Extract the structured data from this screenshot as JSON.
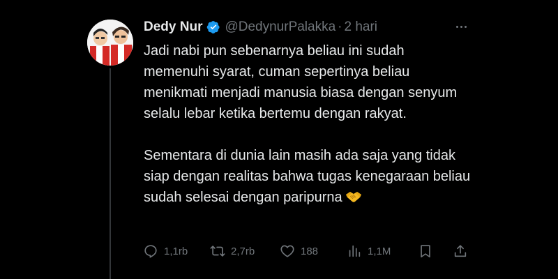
{
  "tweet": {
    "author": {
      "display_name": "Dedy Nur",
      "handle": "@DedynurPalakka",
      "verified": true,
      "avatar_icon": "avatar-illustration"
    },
    "separator": "·",
    "time": "2 hari",
    "more_icon": "more-dots-icon",
    "paragraphs": [
      "Jadi nabi pun sebenarnya beliau ini sudah memenuhi syarat, cuman sepertinya beliau menikmati menjadi manusia biasa dengan senyum selalu lebar ketika bertemu dengan rakyat.",
      "Sementara di dunia lain masih ada saja yang tidak siap dengan realitas bahwa tugas kenegaraan beliau sudah selesai dengan paripurna"
    ],
    "emoji": "handshake-emoji",
    "actions": {
      "reply": {
        "icon": "reply-icon",
        "count": "1,1rb"
      },
      "repost": {
        "icon": "repost-icon",
        "count": "2,7rb"
      },
      "like": {
        "icon": "heart-icon",
        "count": "188"
      },
      "views": {
        "icon": "views-icon",
        "count": "1,1M"
      },
      "bookmark": {
        "icon": "bookmark-icon"
      },
      "share": {
        "icon": "share-icon"
      }
    }
  },
  "colors": {
    "background": "#000000",
    "text": "#e7e9ea",
    "muted": "#71767b",
    "verified_badge": "#1d9bf0",
    "thread_line": "#333639"
  }
}
